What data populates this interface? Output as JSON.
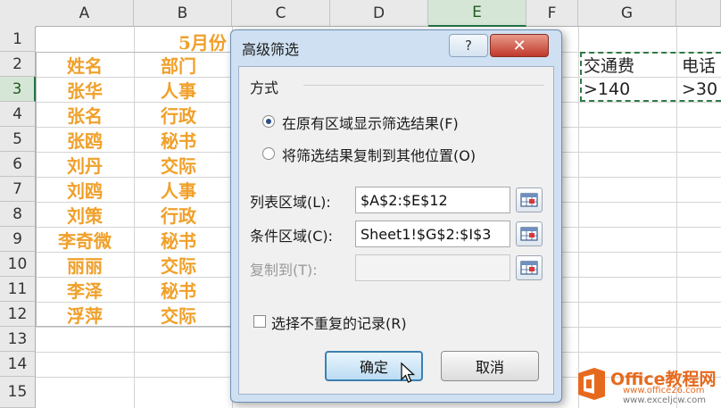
{
  "sheet": {
    "columns": [
      "A",
      "B",
      "C",
      "D",
      "E",
      "F",
      "G",
      ""
    ],
    "rows": [
      "1",
      "2",
      "3",
      "4",
      "5",
      "6",
      "7",
      "8",
      "9",
      "10",
      "11",
      "12",
      "13",
      "14",
      "15"
    ],
    "title_fragment": "5月份",
    "names": [
      "姓名",
      "张华",
      "张名",
      "张鸥",
      "刘丹",
      "刘鸥",
      "刘策",
      "李奇微",
      "丽丽",
      "李泽",
      "浮萍"
    ],
    "depts": [
      "部门",
      "人事",
      "行政",
      "秘书",
      "交际",
      "人事",
      "行政",
      "秘书",
      "交际",
      "秘书",
      "交际"
    ],
    "criteria": {
      "g2": "交通费",
      "h2": "电话",
      "g3": ">140",
      "h3": ">30"
    }
  },
  "dialog": {
    "title": "高级筛选",
    "help_label": "?",
    "close_label": "✕",
    "group_label": "方式",
    "radio_1": "在原有区域显示筛选结果(F)",
    "radio_2": "将筛选结果复制到其他位置(O)",
    "list_range_label": "列表区域(L):",
    "list_range_value": "$A$2:$E$12",
    "criteria_range_label": "条件区域(C):",
    "criteria_range_value": "Sheet1!$G$2:$I$3",
    "copy_to_label": "复制到(T):",
    "copy_to_value": "",
    "unique_label": "选择不重复的记录(R)",
    "ok_label": "确定",
    "cancel_label": "取消"
  },
  "watermark": {
    "brand": "Office教程网",
    "url1": "www.office26.com",
    "url2": "www.exceljcw.com"
  },
  "colors": {
    "accent_orange": "#f0a02a",
    "selection_green": "#217346",
    "dialog_frame": "#cfe0f2"
  }
}
